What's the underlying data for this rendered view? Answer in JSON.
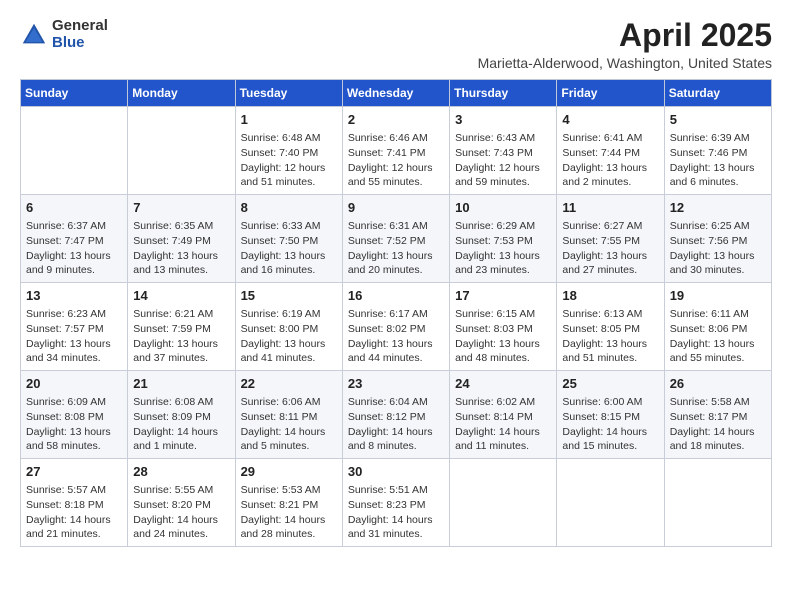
{
  "header": {
    "logo_general": "General",
    "logo_blue": "Blue",
    "month_year": "April 2025",
    "location": "Marietta-Alderwood, Washington, United States"
  },
  "days_of_week": [
    "Sunday",
    "Monday",
    "Tuesday",
    "Wednesday",
    "Thursday",
    "Friday",
    "Saturday"
  ],
  "weeks": [
    [
      {
        "day": "",
        "lines": []
      },
      {
        "day": "",
        "lines": []
      },
      {
        "day": "1",
        "lines": [
          "Sunrise: 6:48 AM",
          "Sunset: 7:40 PM",
          "Daylight: 12 hours",
          "and 51 minutes."
        ]
      },
      {
        "day": "2",
        "lines": [
          "Sunrise: 6:46 AM",
          "Sunset: 7:41 PM",
          "Daylight: 12 hours",
          "and 55 minutes."
        ]
      },
      {
        "day": "3",
        "lines": [
          "Sunrise: 6:43 AM",
          "Sunset: 7:43 PM",
          "Daylight: 12 hours",
          "and 59 minutes."
        ]
      },
      {
        "day": "4",
        "lines": [
          "Sunrise: 6:41 AM",
          "Sunset: 7:44 PM",
          "Daylight: 13 hours",
          "and 2 minutes."
        ]
      },
      {
        "day": "5",
        "lines": [
          "Sunrise: 6:39 AM",
          "Sunset: 7:46 PM",
          "Daylight: 13 hours",
          "and 6 minutes."
        ]
      }
    ],
    [
      {
        "day": "6",
        "lines": [
          "Sunrise: 6:37 AM",
          "Sunset: 7:47 PM",
          "Daylight: 13 hours",
          "and 9 minutes."
        ]
      },
      {
        "day": "7",
        "lines": [
          "Sunrise: 6:35 AM",
          "Sunset: 7:49 PM",
          "Daylight: 13 hours",
          "and 13 minutes."
        ]
      },
      {
        "day": "8",
        "lines": [
          "Sunrise: 6:33 AM",
          "Sunset: 7:50 PM",
          "Daylight: 13 hours",
          "and 16 minutes."
        ]
      },
      {
        "day": "9",
        "lines": [
          "Sunrise: 6:31 AM",
          "Sunset: 7:52 PM",
          "Daylight: 13 hours",
          "and 20 minutes."
        ]
      },
      {
        "day": "10",
        "lines": [
          "Sunrise: 6:29 AM",
          "Sunset: 7:53 PM",
          "Daylight: 13 hours",
          "and 23 minutes."
        ]
      },
      {
        "day": "11",
        "lines": [
          "Sunrise: 6:27 AM",
          "Sunset: 7:55 PM",
          "Daylight: 13 hours",
          "and 27 minutes."
        ]
      },
      {
        "day": "12",
        "lines": [
          "Sunrise: 6:25 AM",
          "Sunset: 7:56 PM",
          "Daylight: 13 hours",
          "and 30 minutes."
        ]
      }
    ],
    [
      {
        "day": "13",
        "lines": [
          "Sunrise: 6:23 AM",
          "Sunset: 7:57 PM",
          "Daylight: 13 hours",
          "and 34 minutes."
        ]
      },
      {
        "day": "14",
        "lines": [
          "Sunrise: 6:21 AM",
          "Sunset: 7:59 PM",
          "Daylight: 13 hours",
          "and 37 minutes."
        ]
      },
      {
        "day": "15",
        "lines": [
          "Sunrise: 6:19 AM",
          "Sunset: 8:00 PM",
          "Daylight: 13 hours",
          "and 41 minutes."
        ]
      },
      {
        "day": "16",
        "lines": [
          "Sunrise: 6:17 AM",
          "Sunset: 8:02 PM",
          "Daylight: 13 hours",
          "and 44 minutes."
        ]
      },
      {
        "day": "17",
        "lines": [
          "Sunrise: 6:15 AM",
          "Sunset: 8:03 PM",
          "Daylight: 13 hours",
          "and 48 minutes."
        ]
      },
      {
        "day": "18",
        "lines": [
          "Sunrise: 6:13 AM",
          "Sunset: 8:05 PM",
          "Daylight: 13 hours",
          "and 51 minutes."
        ]
      },
      {
        "day": "19",
        "lines": [
          "Sunrise: 6:11 AM",
          "Sunset: 8:06 PM",
          "Daylight: 13 hours",
          "and 55 minutes."
        ]
      }
    ],
    [
      {
        "day": "20",
        "lines": [
          "Sunrise: 6:09 AM",
          "Sunset: 8:08 PM",
          "Daylight: 13 hours",
          "and 58 minutes."
        ]
      },
      {
        "day": "21",
        "lines": [
          "Sunrise: 6:08 AM",
          "Sunset: 8:09 PM",
          "Daylight: 14 hours",
          "and 1 minute."
        ]
      },
      {
        "day": "22",
        "lines": [
          "Sunrise: 6:06 AM",
          "Sunset: 8:11 PM",
          "Daylight: 14 hours",
          "and 5 minutes."
        ]
      },
      {
        "day": "23",
        "lines": [
          "Sunrise: 6:04 AM",
          "Sunset: 8:12 PM",
          "Daylight: 14 hours",
          "and 8 minutes."
        ]
      },
      {
        "day": "24",
        "lines": [
          "Sunrise: 6:02 AM",
          "Sunset: 8:14 PM",
          "Daylight: 14 hours",
          "and 11 minutes."
        ]
      },
      {
        "day": "25",
        "lines": [
          "Sunrise: 6:00 AM",
          "Sunset: 8:15 PM",
          "Daylight: 14 hours",
          "and 15 minutes."
        ]
      },
      {
        "day": "26",
        "lines": [
          "Sunrise: 5:58 AM",
          "Sunset: 8:17 PM",
          "Daylight: 14 hours",
          "and 18 minutes."
        ]
      }
    ],
    [
      {
        "day": "27",
        "lines": [
          "Sunrise: 5:57 AM",
          "Sunset: 8:18 PM",
          "Daylight: 14 hours",
          "and 21 minutes."
        ]
      },
      {
        "day": "28",
        "lines": [
          "Sunrise: 5:55 AM",
          "Sunset: 8:20 PM",
          "Daylight: 14 hours",
          "and 24 minutes."
        ]
      },
      {
        "day": "29",
        "lines": [
          "Sunrise: 5:53 AM",
          "Sunset: 8:21 PM",
          "Daylight: 14 hours",
          "and 28 minutes."
        ]
      },
      {
        "day": "30",
        "lines": [
          "Sunrise: 5:51 AM",
          "Sunset: 8:23 PM",
          "Daylight: 14 hours",
          "and 31 minutes."
        ]
      },
      {
        "day": "",
        "lines": []
      },
      {
        "day": "",
        "lines": []
      },
      {
        "day": "",
        "lines": []
      }
    ]
  ]
}
